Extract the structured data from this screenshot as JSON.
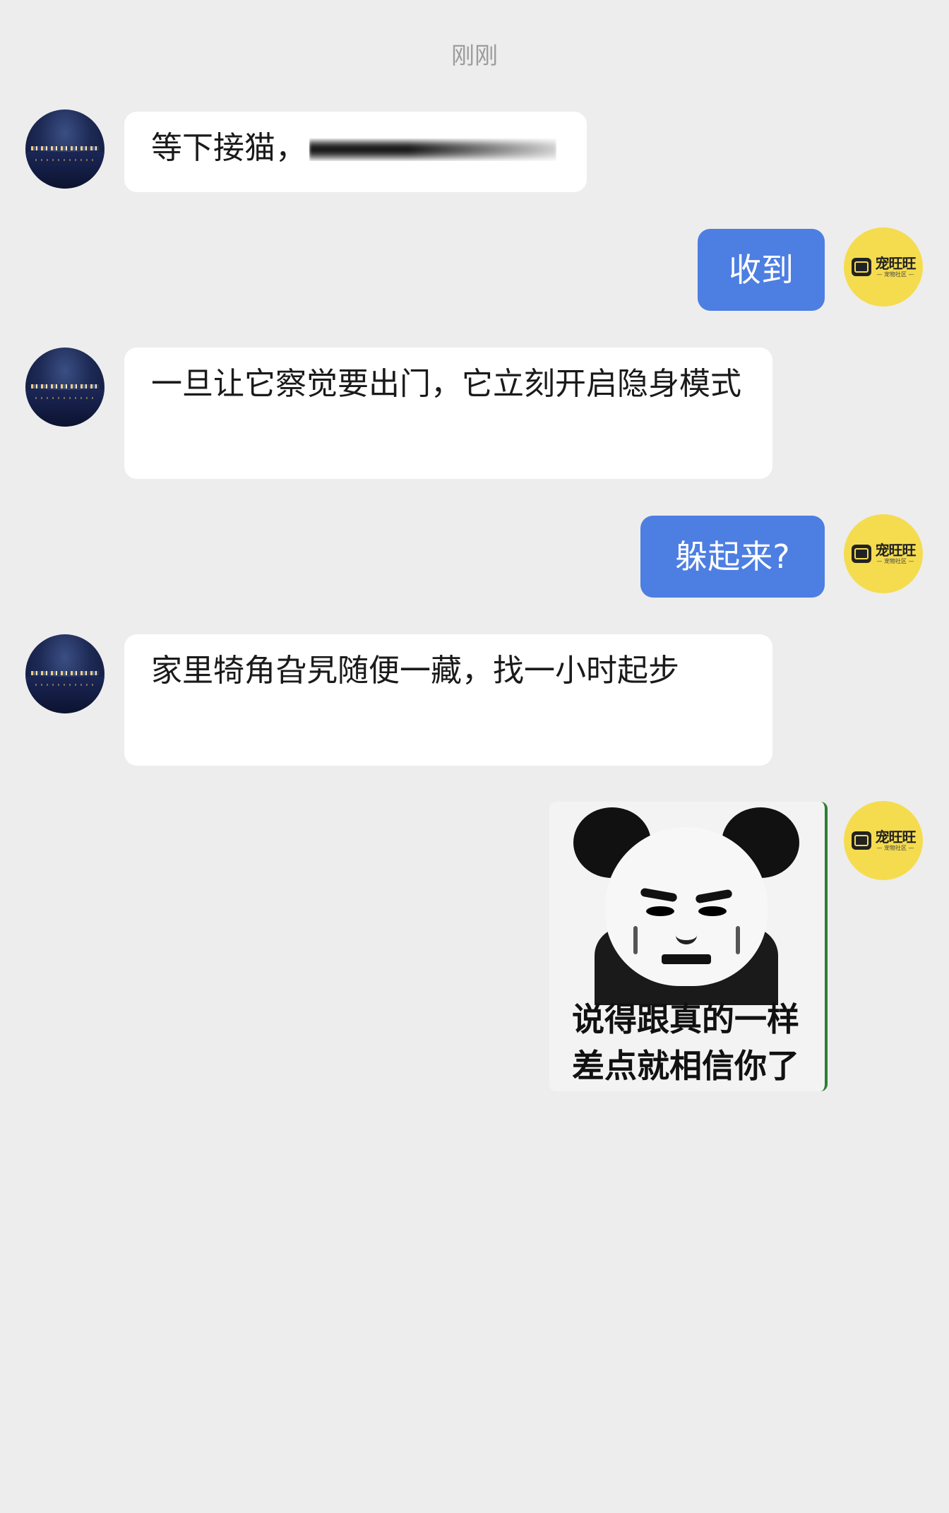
{
  "timestamp": "刚刚",
  "contact_avatar_icon": "night-harbor-avatar",
  "self_avatar": {
    "title": "宠旺旺",
    "subtitle": "— 宠物社区 —",
    "icon": "pet-logo-icon",
    "color": "#f5dc4f"
  },
  "messages": [
    {
      "side": "left",
      "text": "等下接猫，",
      "redacted": true
    },
    {
      "side": "right",
      "text": "收到"
    },
    {
      "side": "left",
      "text": "一旦让它察觉要出门，它立刻开启隐身模式"
    },
    {
      "side": "right",
      "text": "躲起来?"
    },
    {
      "side": "left",
      "text": "家里犄角旮旯随便一藏，找一小时起步"
    },
    {
      "side": "right",
      "type": "sticker",
      "caption_line1": "说得跟真的一样",
      "caption_line2": "差点就相信你了"
    }
  ],
  "colors": {
    "background": "#ededed",
    "bubble_self": "#4d7ee2",
    "bubble_other": "#ffffff"
  }
}
